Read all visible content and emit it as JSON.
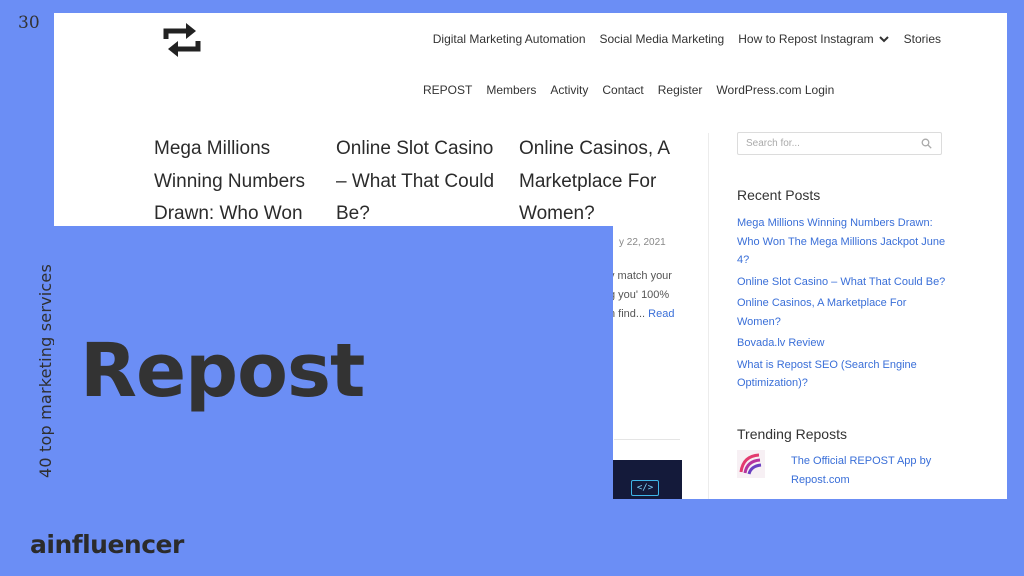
{
  "slide": {
    "number": "30",
    "side_caption": "40 top marketing services",
    "brand": "ainfluencer",
    "title": "Repost"
  },
  "nav": {
    "row1": [
      "Digital Marketing Automation",
      "Social Media Marketing",
      "How to Repost Instagram",
      "Stories"
    ],
    "row2": [
      "REPOST",
      "Members",
      "Activity",
      "Contact",
      "Register",
      "WordPress.com Login"
    ]
  },
  "posts": [
    {
      "title": "Mega Millions Winning Numbers Drawn: Who Won"
    },
    {
      "title": "Online Slot Casino – What That Could Be?"
    },
    {
      "title": "Online Casinos, A Marketplace For Women?"
    }
  ],
  "post_meta": {
    "date_fragment": "y 22, 2021",
    "excerpt_lines": [
      "y match your",
      "g you' 100%",
      "n find..."
    ],
    "read_more": "Read"
  },
  "thumb_code": "</>",
  "sidebar": {
    "search_placeholder": "Search for...",
    "recent_posts_title": "Recent Posts",
    "recent_posts": [
      "Mega Millions Winning Numbers Drawn: Who Won The Mega Millions Jackpot June 4?",
      "Online Slot Casino – What That Could Be?",
      "Online Casinos, A Marketplace For Women?",
      "Bovada.lv Review",
      "What is Repost SEO (Search Engine Optimization)?"
    ],
    "trending_title": "Trending Reposts",
    "trending_item": "The Official REPOST App by Repost.com"
  },
  "colors": {
    "background": "#6b8ef5",
    "link": "#3a6fd8",
    "text_dark": "#333333"
  },
  "icons": [
    "repost-logo-icon",
    "chevron-down-icon",
    "search-icon",
    "repost-app-icon"
  ]
}
